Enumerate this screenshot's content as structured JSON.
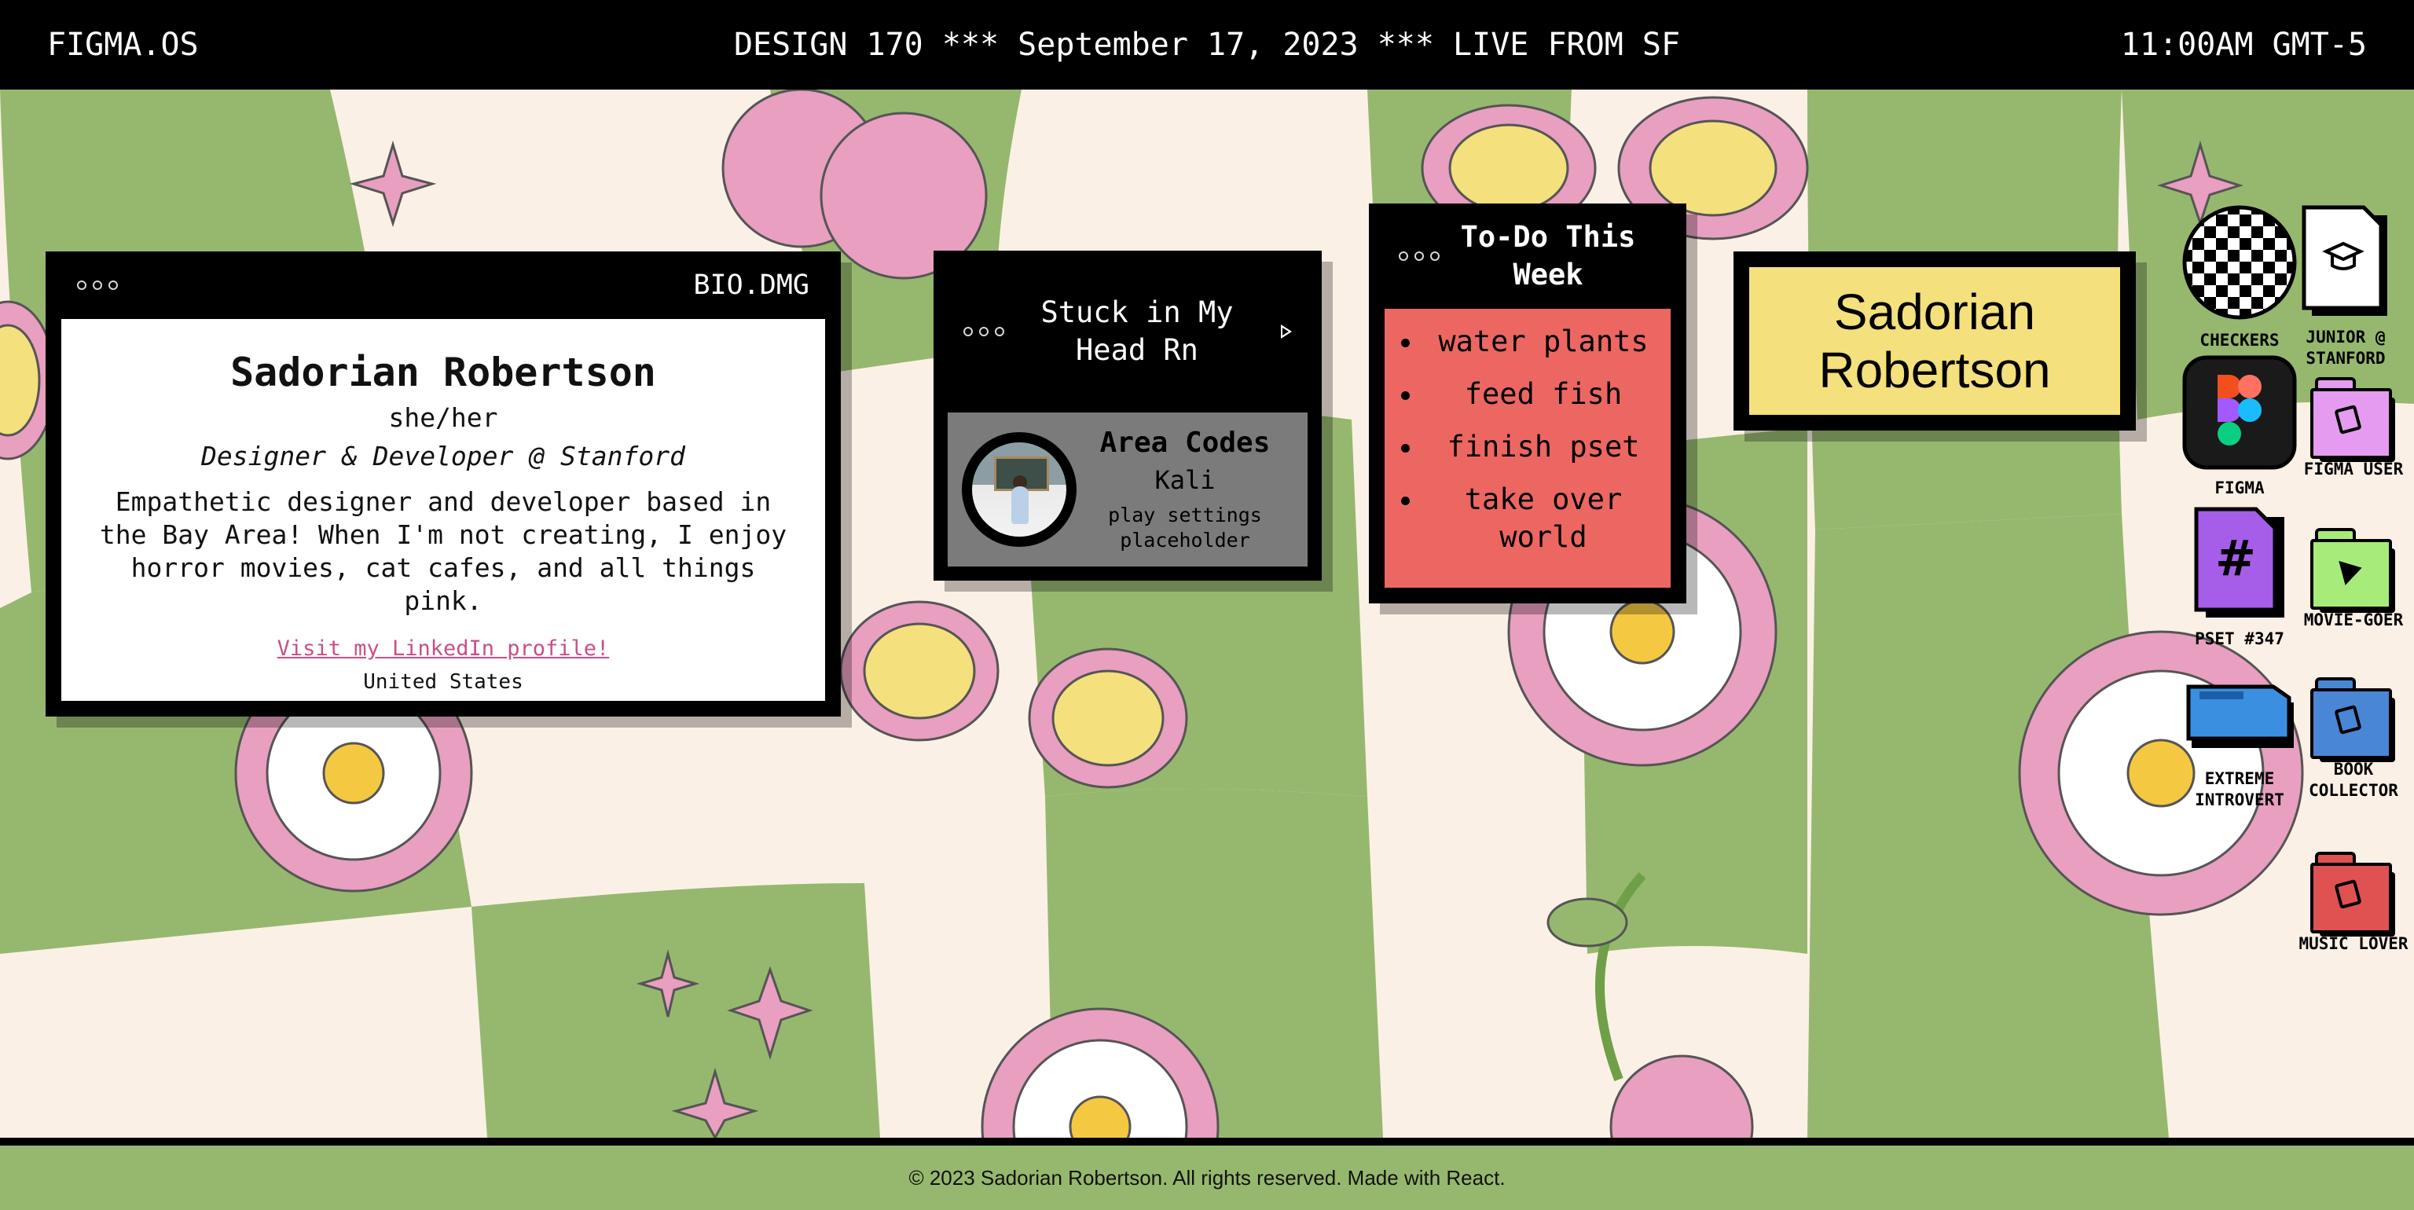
{
  "topbar": {
    "left": "FIGMA.OS",
    "center": "DESIGN 170 *** September 17, 2023 *** LIVE FROM SF",
    "right": "11:00AM GMT-5"
  },
  "bio": {
    "window_title": "BIO.DMG",
    "name": "Sadorian Robertson",
    "pronouns": "she/her",
    "role": "Designer & Developer @ Stanford",
    "description": "Empathetic designer and developer based in the Bay Area! When I'm not creating, I enjoy horror movies, cat cafes, and all things pink.",
    "link": "Visit my LinkedIn profile!",
    "location": "United States"
  },
  "music": {
    "window_title": "Stuck in My Head Rn",
    "song": "Area Codes",
    "artist": "Kali",
    "settings": "play settings placeholder"
  },
  "todo": {
    "window_title": "To-Do This Week",
    "items": [
      "water plants",
      "feed fish",
      "finish pset",
      "take over world"
    ]
  },
  "namecard": {
    "text": "Sadorian Robertson"
  },
  "desktop_icons": [
    {
      "label": "CHECKERS",
      "icon": "checkers-icon"
    },
    {
      "label": "JUNIOR @ STANFORD",
      "icon": "graduation-cap-file-icon"
    },
    {
      "label": "FIGMA",
      "icon": "figma-logo-icon"
    },
    {
      "label": "FIGMA USER",
      "icon": "figma-folder-icon"
    },
    {
      "label": "PSET #347",
      "icon": "hashtag-file-icon"
    },
    {
      "label": "MOVIE-GOER",
      "icon": "play-folder-icon"
    },
    {
      "label": "EXTREME INTROVERT",
      "icon": "drive-icon"
    },
    {
      "label": "BOOK COLLECTOR",
      "icon": "book-folder-icon"
    },
    {
      "label": "MUSIC LOVER",
      "icon": "music-folder-icon"
    }
  ],
  "footer": {
    "text": "© 2023 Sadorian Robertson. All rights reserved. Made with React."
  },
  "colors": {
    "bar": "#000000",
    "cream": "#fbf0e6",
    "green": "#96b86e",
    "pink": "#e89fc0",
    "yellow": "#f4e07c",
    "todo_red": "#ec6762",
    "link_pink": "#c94f86"
  }
}
